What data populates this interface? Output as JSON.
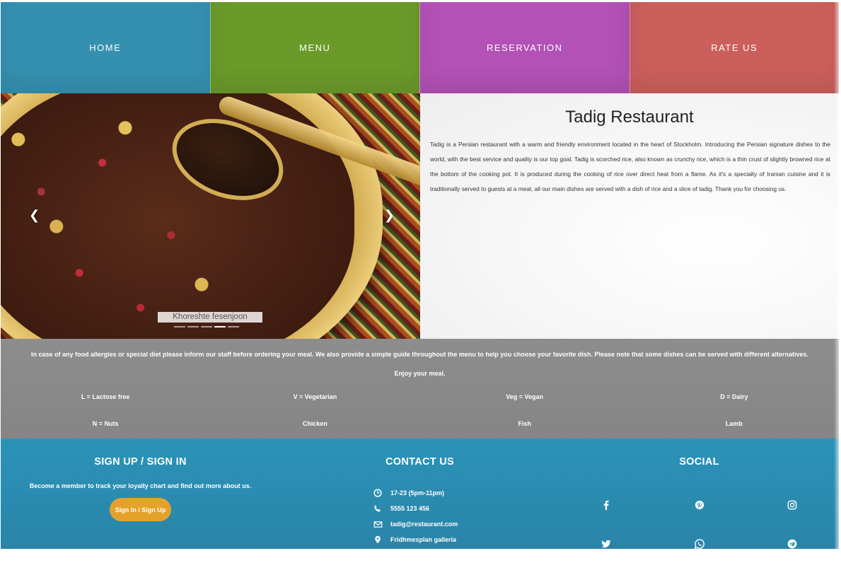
{
  "nav": {
    "items": [
      {
        "label": "HOME",
        "color": "#3590b0"
      },
      {
        "label": "MENU",
        "color": "#6a9a2a"
      },
      {
        "label": "RESERVATION",
        "color": "#b351b6"
      },
      {
        "label": "RATE US",
        "color": "#cb5f5c"
      }
    ]
  },
  "carousel": {
    "caption": "Khoreshte fesenjoon",
    "prev_icon": "chevron-left-icon",
    "next_icon": "chevron-right-icon",
    "indicator_count": 5,
    "active_indicator": 4
  },
  "about": {
    "title": "Tadig Restaurant",
    "text": "Tadig is a Persian restaurant with a warm and friendly environment located in the heart of Stockholm. Introducing the Persian signature dishes to the world, with the best service and quality is our top goal. Tadig is scorched rice, also known as crunchy rice, which is a thin crust of slightly browned rice at the bottom of the cooking pot. It is produced during the cooking of rice over direct heat from a flame. As it's a specialty of Iranian cuisine and it is traditionally served to guests at a meal, all our main dishes are served with a dish of rice and a slice of tadig. Thank you for choosing us."
  },
  "allergy": {
    "note": "In case of any food allergies or special diet please inform our staff before ordering your meal. We also provide a simple guide throughout the menu to help you choose your favorite dish. Please note that some dishes can be served with different alternatives.",
    "enjoy": "Enjoy your meal.",
    "legend_row1": [
      "L = Lactose free",
      "V = Vegetarian",
      "Veg = Vegan",
      "D = Dairy"
    ],
    "legend_row2": [
      "N = Nuts",
      "Chicken",
      "Fish",
      "Lamb"
    ]
  },
  "footer": {
    "signup": {
      "title": "SIGN UP / SIGN IN",
      "description": "Become a member to track your loyalty chart and find out more about us.",
      "button_label": "Sign In / Sign Up"
    },
    "contact": {
      "title": "CONTACT US",
      "hours": "17-23 (5pm-11pm)",
      "phone": "5555 123 456",
      "email": "tadig@restaurant.com",
      "address": "Fridhmesplan galleria"
    },
    "social": {
      "title": "SOCIAL",
      "icons": [
        "facebook-icon",
        "pinterest-icon",
        "instagram-icon",
        "twitter-icon",
        "whatsapp-icon",
        "telegram-icon"
      ]
    }
  },
  "colors": {
    "footer_bg": "#2b8db3",
    "allergy_bg": "#8a8a8a",
    "button_bg": "#e5a22a"
  }
}
